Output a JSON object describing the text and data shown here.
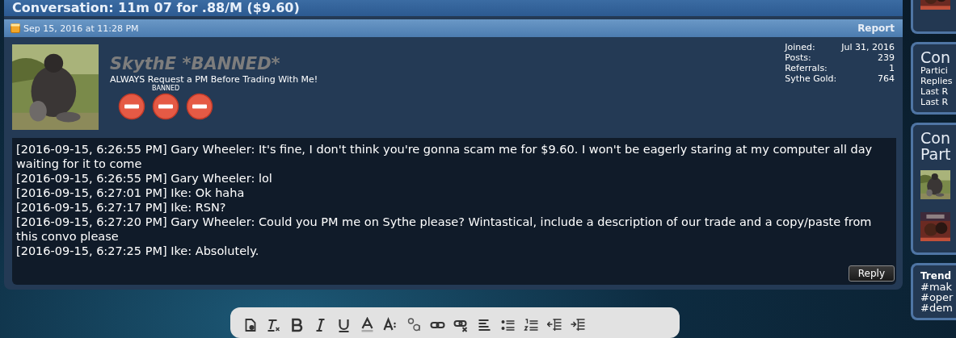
{
  "thread": {
    "title": "Conversation: 11m 07 for .88/M ($9.60)"
  },
  "post": {
    "date": "Sep 15, 2016 at 11:28 PM",
    "report": "Report",
    "user": {
      "name": "SkythE *BANNED*",
      "tagline": "ALWAYS Request a PM Before Trading With Me!",
      "badges": [
        {
          "kind": "banned"
        },
        {
          "kind": "banned",
          "label": "BANNED"
        },
        {
          "kind": "banned"
        }
      ]
    },
    "stats": [
      {
        "label": "Joined:",
        "value": "Jul 31, 2016"
      },
      {
        "label": "Posts:",
        "value": "239"
      },
      {
        "label": "Referrals:",
        "value": "1"
      },
      {
        "label": "Sythe Gold:",
        "value": "764"
      }
    ],
    "messages": [
      "[2016-09-15, 6:26:55 PM] Gary Wheeler: It's fine, I don't think you're gonna scam me for $9.60. I won't be eagerly staring at my computer all day waiting for it to come",
      "[2016-09-15, 6:26:55 PM] Gary Wheeler: lol",
      "[2016-09-15, 6:27:01 PM] Ike: Ok haha",
      "[2016-09-15, 6:27:17 PM] Ike: RSN?",
      "[2016-09-15, 6:27:20 PM] Gary Wheeler: Could you PM me on Sythe please? Wintastical, include a description of our trade and a copy/paste from this convo please",
      "[2016-09-15, 6:27:25 PM] Ike: Absolutely."
    ],
    "reply": "Reply"
  },
  "editor_toolbar": [
    {
      "kind": "paste"
    },
    {
      "kind": "clear-format"
    },
    {
      "kind": "bold"
    },
    {
      "kind": "italic"
    },
    {
      "kind": "underline"
    },
    {
      "kind": "text-color"
    },
    {
      "kind": "font-size"
    },
    {
      "kind": "sub-super"
    },
    {
      "kind": "link"
    },
    {
      "kind": "unlink"
    },
    {
      "kind": "align"
    },
    {
      "kind": "bullets"
    },
    {
      "kind": "numbers"
    },
    {
      "kind": "outdent"
    },
    {
      "kind": "indent"
    }
  ],
  "sidebar": {
    "info_panel": {
      "title": "Con",
      "lines": [
        "Partici",
        "Replies",
        "Last R",
        "Last R"
      ]
    },
    "participants_panel": {
      "title_lines": [
        "Con",
        "Part"
      ],
      "avatars": [
        {
          "kind": "picture"
        },
        {
          "kind": "picture"
        }
      ]
    },
    "trending_panel": {
      "title": "Trend",
      "tags": [
        "#mak",
        "#oper",
        "#dem"
      ]
    }
  }
}
